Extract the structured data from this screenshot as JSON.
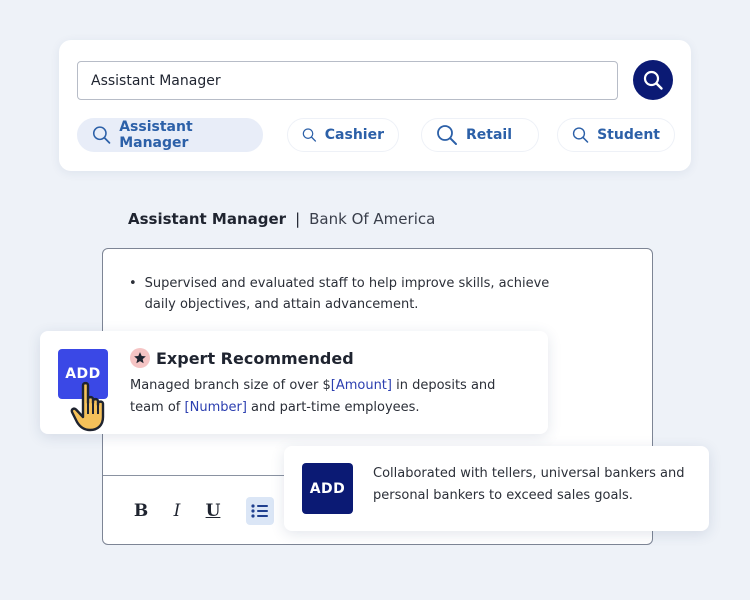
{
  "search": {
    "value": "Assistant Manager",
    "button_icon": "search-icon",
    "chips": [
      {
        "label": "Assistant Manager",
        "icon": "search-icon"
      },
      {
        "label": "Cashier",
        "icon": "search-icon"
      },
      {
        "label": "Retail",
        "icon": "search-icon"
      },
      {
        "label": "Student",
        "icon": "search-icon"
      }
    ]
  },
  "job": {
    "title": "Assistant Manager",
    "separator": "|",
    "company": "Bank Of America"
  },
  "editor": {
    "bullet_text": "Supervised and evaluated staff to help improve skills, achieve daily objectives, and attain advancement.",
    "toolbar": {
      "bold": "B",
      "italic": "I",
      "underline": "U",
      "list_icon": "bulleted-list-icon"
    }
  },
  "expert_suggestion": {
    "add_label": "ADD",
    "badge_icon": "star-icon",
    "heading": "Expert Recommended",
    "text_before_amount": "Managed branch size of over $",
    "amount_placeholder": "[Amount]",
    "text_after_amount": " in deposits and team of ",
    "number_placeholder": "[Number]",
    "text_end": " and part-time employees."
  },
  "collab_suggestion": {
    "add_label": "ADD",
    "text": "Collaborated with tellers, universal bankers and personal bankers to exceed sales goals."
  },
  "colors": {
    "primary_navy": "#0b1a74",
    "add_blue": "#3a48e6",
    "chip_text": "#2c60a8",
    "placeholder_blue": "#2c3fb0",
    "star_badge_bg": "#f5c4c4"
  }
}
